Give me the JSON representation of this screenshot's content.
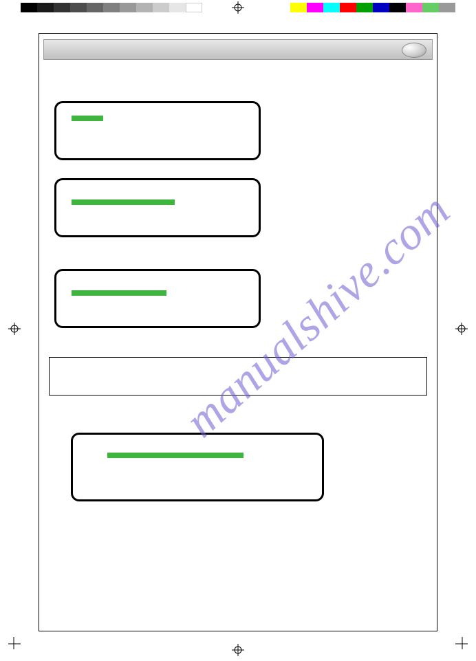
{
  "watermark": "manualshive.com",
  "print_marks": {
    "grayscale_steps": [
      "#000000",
      "#1a1a1a",
      "#333333",
      "#4d4d4d",
      "#666666",
      "#808080",
      "#999999",
      "#b3b3b3",
      "#cccccc",
      "#e6e6e6",
      "#ffffff"
    ],
    "color_steps": [
      "#ffff00",
      "#ff00ff",
      "#00ffff",
      "#ff0000",
      "#00a000",
      "#0000c0",
      "#000000",
      "#ff66cc",
      "#66cc66",
      "#999999"
    ]
  },
  "boxes": {
    "box1_label": "",
    "box2_label": "",
    "box3_label": "",
    "box5_label": ""
  }
}
